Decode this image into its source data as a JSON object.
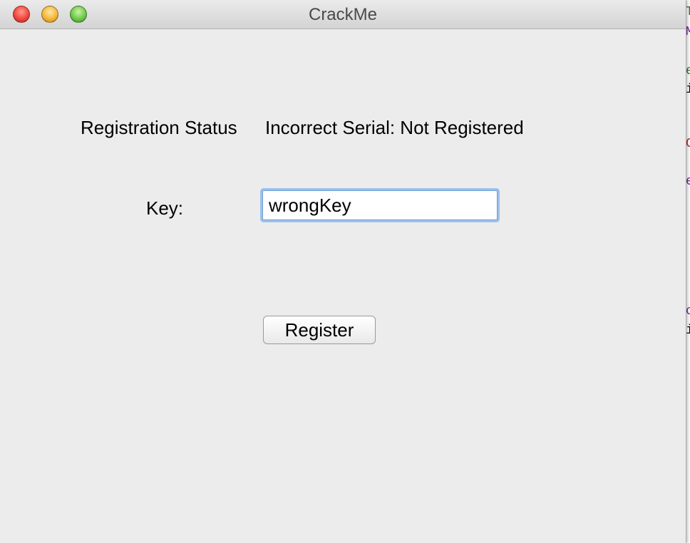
{
  "window": {
    "title": "CrackMe"
  },
  "status": {
    "label": "Registration Status",
    "value": "Incorrect Serial: Not Registered"
  },
  "key": {
    "label": "Key:",
    "input_value": "wrongKey"
  },
  "register_button": {
    "label": "Register"
  },
  "background_editor": {
    "glyphs": [
      "T",
      "M",
      "e",
      "i",
      "C",
      "e",
      "c",
      "i"
    ]
  },
  "colors": {
    "window_bg": "#ececec",
    "focus_ring": "#9ec1ea",
    "close": "#f2473f",
    "minimize": "#f6b73a",
    "maximize": "#6fc94a"
  }
}
